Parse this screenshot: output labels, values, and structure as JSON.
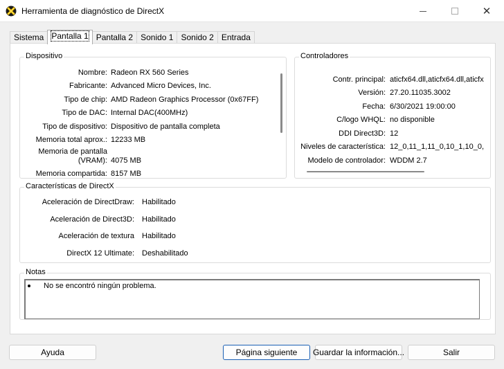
{
  "window": {
    "title": "Herramienta de diagnóstico de DirectX"
  },
  "tabs": [
    {
      "label": "Sistema",
      "active": false
    },
    {
      "label": "Pantalla 1",
      "active": true
    },
    {
      "label": "Pantalla 2",
      "active": false
    },
    {
      "label": "Sonido 1",
      "active": false
    },
    {
      "label": "Sonido 2",
      "active": false
    },
    {
      "label": "Entrada",
      "active": false
    }
  ],
  "device": {
    "title": "Dispositivo",
    "rows": [
      {
        "label": "Nombre:",
        "value": "Radeon RX 560 Series"
      },
      {
        "label": "Fabricante:",
        "value": "Advanced Micro Devices, Inc."
      },
      {
        "label": "Tipo de chip:",
        "value": "AMD Radeon Graphics Processor (0x67FF)"
      },
      {
        "label": "Tipo de DAC:",
        "value": "Internal DAC(400MHz)"
      },
      {
        "label": "Tipo de dispositivo:",
        "value": "Dispositivo de pantalla completa"
      },
      {
        "label": "Memoria total aprox.:",
        "value": "12233 MB"
      },
      {
        "label": "Memoria de pantalla",
        "label2": "(VRAM):",
        "value": "4075 MB"
      },
      {
        "label": "Memoria compartida:",
        "value": "8157 MB"
      }
    ]
  },
  "drivers": {
    "title": "Controladores",
    "rows": [
      {
        "label": "Contr. principal:",
        "value": "aticfx64.dll,aticfx64.dll,aticfx"
      },
      {
        "label": "Versión:",
        "value": "27.20.11035.3002"
      },
      {
        "label": "Fecha:",
        "value": "6/30/2021 19:00:00"
      },
      {
        "label": "C/logo WHQL:",
        "value": "no disponible"
      },
      {
        "label": "DDI Direct3D:",
        "value": "12"
      },
      {
        "label": "Niveles de característica:",
        "value": "12_0,11_1,11_0,10_1,10_0,"
      },
      {
        "label": "Modelo de controlador:",
        "value": "WDDM 2.7"
      }
    ]
  },
  "features": {
    "title": "Características de DirectX",
    "rows": [
      {
        "label": "Aceleración de DirectDraw:",
        "value": "Habilitado"
      },
      {
        "label": "Aceleración de Direct3D:",
        "value": "Habilitado"
      },
      {
        "label": "Aceleración de textura",
        "value": "Habilitado"
      },
      {
        "label": "DirectX 12 Ultimate:",
        "value": "Deshabilitado"
      }
    ]
  },
  "notes": {
    "title": "Notas",
    "items": [
      "No se encontró ningún problema."
    ]
  },
  "buttons": {
    "help": "Ayuda",
    "next": "Página siguiente",
    "save": "Guardar la información...",
    "exit": "Salir"
  },
  "colors": {
    "primary_border": "#1a5fb4",
    "dialog_bg": "#f0f0f0",
    "panel_bg": "#ffffff"
  }
}
